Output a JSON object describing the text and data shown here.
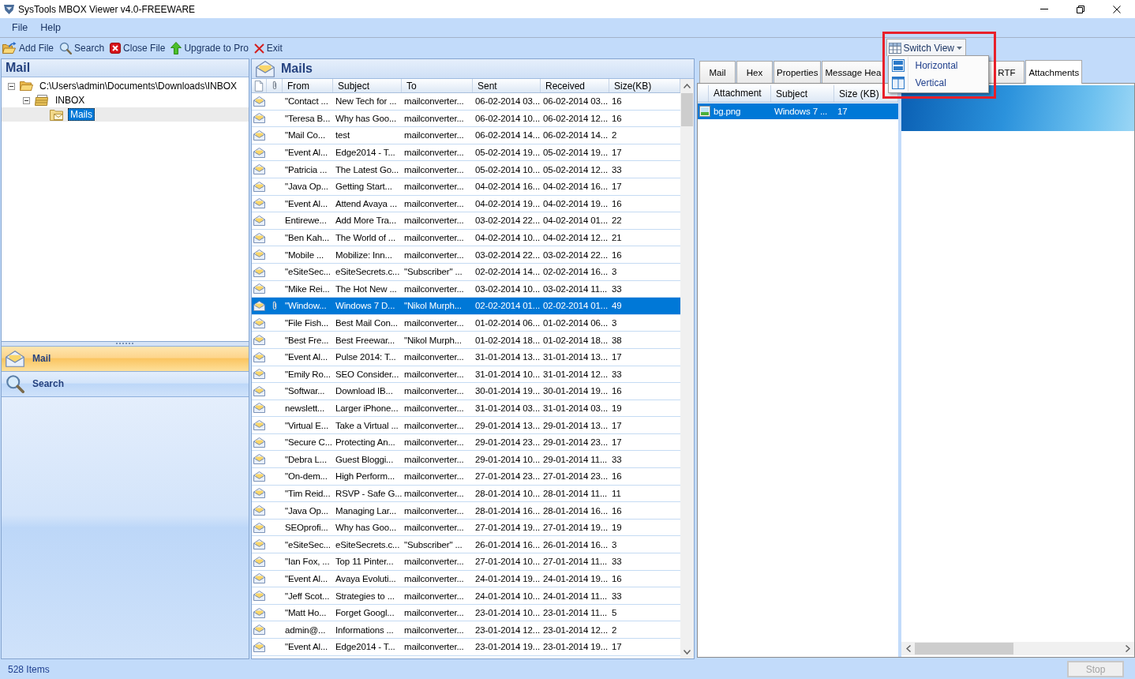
{
  "window": {
    "title": "SysTools MBOX Viewer v4.0-FREEWARE"
  },
  "menu": [
    "File",
    "Help"
  ],
  "toolbar": [
    {
      "label": "Add File",
      "kind": "add-file"
    },
    {
      "label": "Search",
      "kind": "search"
    },
    {
      "label": "Close File",
      "kind": "close-file"
    },
    {
      "label": "Upgrade to Pro",
      "kind": "upgrade"
    },
    {
      "label": "Exit",
      "kind": "exit"
    }
  ],
  "switch_view": {
    "label": "Switch View",
    "expanded": true,
    "options": [
      {
        "label": "Horizontal",
        "kind": "horizontal"
      },
      {
        "label": "Vertical",
        "kind": "vertical"
      }
    ]
  },
  "left_pane": {
    "title": "Mail",
    "tree": [
      {
        "label": "C:\\Users\\admin\\Documents\\Downloads\\INBOX",
        "kind": "folder",
        "expanded": true,
        "selected": false,
        "children": [
          {
            "label": "INBOX",
            "kind": "mailbox",
            "expanded": true,
            "selected": false,
            "children": [
              {
                "label": "Mails",
                "kind": "mail-folder",
                "selected": true
              }
            ]
          }
        ]
      }
    ],
    "nav": [
      {
        "label": "Mail",
        "kind": "mail",
        "selected": true
      },
      {
        "label": "Search",
        "kind": "search",
        "selected": false
      }
    ]
  },
  "mail_list": {
    "title": "Mails",
    "columns": [
      "From",
      "Subject",
      "To",
      "Sent",
      "Received",
      "Size(KB)"
    ],
    "rows": [
      {
        "from": "\"Contact ...",
        "subject": "New Tech for ...",
        "to": "mailconverter...",
        "sent": "06-02-2014 03...",
        "received": "06-02-2014 03...",
        "size": "16",
        "attachment": false,
        "selected": false
      },
      {
        "from": "\"Teresa B...",
        "subject": "Why has Goo...",
        "to": "mailconverter...",
        "sent": "06-02-2014 10...",
        "received": "06-02-2014 12...",
        "size": "16",
        "attachment": false,
        "selected": false
      },
      {
        "from": "\"Mail Co...",
        "subject": "test",
        "to": "mailconverter...",
        "sent": "06-02-2014 14...",
        "received": "06-02-2014 14...",
        "size": "2",
        "attachment": false,
        "selected": false
      },
      {
        "from": "\"Event Al...",
        "subject": "Edge2014 - T...",
        "to": "mailconverter...",
        "sent": "05-02-2014 19...",
        "received": "05-02-2014 19...",
        "size": "17",
        "attachment": false,
        "selected": false
      },
      {
        "from": "\"Patricia ...",
        "subject": "The Latest Go...",
        "to": "mailconverter...",
        "sent": "05-02-2014 10...",
        "received": "05-02-2014 12...",
        "size": "33",
        "attachment": false,
        "selected": false
      },
      {
        "from": "\"Java Op...",
        "subject": "Getting Start...",
        "to": "mailconverter...",
        "sent": "04-02-2014 16...",
        "received": "04-02-2014 16...",
        "size": "17",
        "attachment": false,
        "selected": false
      },
      {
        "from": "\"Event Al...",
        "subject": "Attend Avaya ...",
        "to": "mailconverter...",
        "sent": "04-02-2014 19...",
        "received": "04-02-2014 19...",
        "size": "16",
        "attachment": false,
        "selected": false
      },
      {
        "from": "Entirewe...",
        "subject": "Add More Tra...",
        "to": "mailconverter...",
        "sent": "03-02-2014 22...",
        "received": "04-02-2014 01...",
        "size": "22",
        "attachment": false,
        "selected": false
      },
      {
        "from": "\"Ben Kah...",
        "subject": "The World of ...",
        "to": "mailconverter...",
        "sent": "04-02-2014 10...",
        "received": "04-02-2014 12...",
        "size": "21",
        "attachment": false,
        "selected": false
      },
      {
        "from": "\"Mobile ...",
        "subject": "Mobilize: Inn...",
        "to": "mailconverter...",
        "sent": "03-02-2014 22...",
        "received": "03-02-2014 22...",
        "size": "16",
        "attachment": false,
        "selected": false
      },
      {
        "from": "\"eSiteSec...",
        "subject": "eSiteSecrets.c...",
        "to": "\"Subscriber\" ...",
        "sent": "02-02-2014 14...",
        "received": "02-02-2014 16...",
        "size": "3",
        "attachment": false,
        "selected": false
      },
      {
        "from": "\"Mike Rei...",
        "subject": "The Hot New ...",
        "to": "mailconverter...",
        "sent": "03-02-2014 10...",
        "received": "03-02-2014 11...",
        "size": "33",
        "attachment": false,
        "selected": false
      },
      {
        "from": "\"Window...",
        "subject": "Windows 7 D...",
        "to": "\"Nikol Murph...",
        "sent": "02-02-2014 01...",
        "received": "02-02-2014 01...",
        "size": "49",
        "attachment": true,
        "selected": true
      },
      {
        "from": "\"File Fish...",
        "subject": "Best Mail Con...",
        "to": "mailconverter...",
        "sent": "01-02-2014 06...",
        "received": "01-02-2014 06...",
        "size": "3",
        "attachment": false,
        "selected": false
      },
      {
        "from": "\"Best Fre...",
        "subject": "Best Freewar...",
        "to": "\"Nikol Murph...",
        "sent": "01-02-2014 18...",
        "received": "01-02-2014 18...",
        "size": "38",
        "attachment": false,
        "selected": false
      },
      {
        "from": "\"Event Al...",
        "subject": "Pulse 2014: T...",
        "to": "mailconverter...",
        "sent": "31-01-2014 13...",
        "received": "31-01-2014 13...",
        "size": "17",
        "attachment": false,
        "selected": false
      },
      {
        "from": "\"Emily Ro...",
        "subject": "SEO Consider...",
        "to": "mailconverter...",
        "sent": "31-01-2014 10...",
        "received": "31-01-2014 12...",
        "size": "33",
        "attachment": false,
        "selected": false
      },
      {
        "from": "\"Softwar...",
        "subject": "Download IB...",
        "to": "mailconverter...",
        "sent": "30-01-2014 19...",
        "received": "30-01-2014 19...",
        "size": "16",
        "attachment": false,
        "selected": false
      },
      {
        "from": "newslett...",
        "subject": "Larger iPhone...",
        "to": "mailconverter...",
        "sent": "31-01-2014 03...",
        "received": "31-01-2014 03...",
        "size": "19",
        "attachment": false,
        "selected": false
      },
      {
        "from": "\"Virtual E...",
        "subject": "Take a Virtual ...",
        "to": "mailconverter...",
        "sent": "29-01-2014 13...",
        "received": "29-01-2014 13...",
        "size": "17",
        "attachment": false,
        "selected": false
      },
      {
        "from": "\"Secure C...",
        "subject": "Protecting An...",
        "to": "mailconverter...",
        "sent": "29-01-2014 23...",
        "received": "29-01-2014 23...",
        "size": "17",
        "attachment": false,
        "selected": false
      },
      {
        "from": "\"Debra L...",
        "subject": "Guest Bloggi...",
        "to": "mailconverter...",
        "sent": "29-01-2014 10...",
        "received": "29-01-2014 11...",
        "size": "33",
        "attachment": false,
        "selected": false
      },
      {
        "from": "\"On-dem...",
        "subject": "High Perform...",
        "to": "mailconverter...",
        "sent": "27-01-2014 23...",
        "received": "27-01-2014 23...",
        "size": "16",
        "attachment": false,
        "selected": false
      },
      {
        "from": "\"Tim Reid...",
        "subject": "RSVP - Safe G...",
        "to": "mailconverter...",
        "sent": "28-01-2014 10...",
        "received": "28-01-2014 11...",
        "size": "11",
        "attachment": false,
        "selected": false
      },
      {
        "from": "\"Java Op...",
        "subject": "Managing Lar...",
        "to": "mailconverter...",
        "sent": "28-01-2014 16...",
        "received": "28-01-2014 16...",
        "size": "16",
        "attachment": false,
        "selected": false
      },
      {
        "from": "SEOprofi...",
        "subject": "Why has Goo...",
        "to": "mailconverter...",
        "sent": "27-01-2014 19...",
        "received": "27-01-2014 19...",
        "size": "19",
        "attachment": false,
        "selected": false
      },
      {
        "from": "\"eSiteSec...",
        "subject": "eSiteSecrets.c...",
        "to": "\"Subscriber\" ...",
        "sent": "26-01-2014 16...",
        "received": "26-01-2014 16...",
        "size": "3",
        "attachment": false,
        "selected": false
      },
      {
        "from": "\"Ian Fox, ...",
        "subject": "Top 11 Pinter...",
        "to": "mailconverter...",
        "sent": "27-01-2014 10...",
        "received": "27-01-2014 11...",
        "size": "33",
        "attachment": false,
        "selected": false
      },
      {
        "from": "\"Event Al...",
        "subject": "Avaya Evoluti...",
        "to": "mailconverter...",
        "sent": "24-01-2014 19...",
        "received": "24-01-2014 19...",
        "size": "16",
        "attachment": false,
        "selected": false
      },
      {
        "from": "\"Jeff Scot...",
        "subject": "Strategies to ...",
        "to": "mailconverter...",
        "sent": "24-01-2014 10...",
        "received": "24-01-2014 11...",
        "size": "33",
        "attachment": false,
        "selected": false
      },
      {
        "from": "\"Matt Ho...",
        "subject": "Forget Googl...",
        "to": "mailconverter...",
        "sent": "23-01-2014 10...",
        "received": "23-01-2014 11...",
        "size": "5",
        "attachment": false,
        "selected": false
      },
      {
        "from": "admin@...",
        "subject": "Informations ...",
        "to": "mailconverter...",
        "sent": "23-01-2014 12...",
        "received": "23-01-2014 12...",
        "size": "2",
        "attachment": false,
        "selected": false
      },
      {
        "from": "\"Event Al...",
        "subject": "Edge2014 - T...",
        "to": "mailconverter...",
        "sent": "23-01-2014 19...",
        "received": "23-01-2014 19...",
        "size": "17",
        "attachment": false,
        "selected": false
      }
    ]
  },
  "preview": {
    "tabs": [
      {
        "label": "Mail",
        "selected": false
      },
      {
        "label": "Hex",
        "selected": false
      },
      {
        "label": "Properties",
        "selected": false
      },
      {
        "label": "Message Hea",
        "selected": false
      },
      {
        "label": "RTF",
        "selected": false
      },
      {
        "label": "Attachments",
        "selected": true
      }
    ],
    "attachments": {
      "columns": [
        "Attachment",
        "Subject",
        "Size (KB)"
      ],
      "rows": [
        {
          "name": "bg.png",
          "subject": "Windows 7 ...",
          "size": "17",
          "selected": true
        }
      ]
    }
  },
  "status_bar": {
    "count": "528 Items",
    "stop_button": {
      "label": "Stop",
      "disabled": true
    }
  }
}
